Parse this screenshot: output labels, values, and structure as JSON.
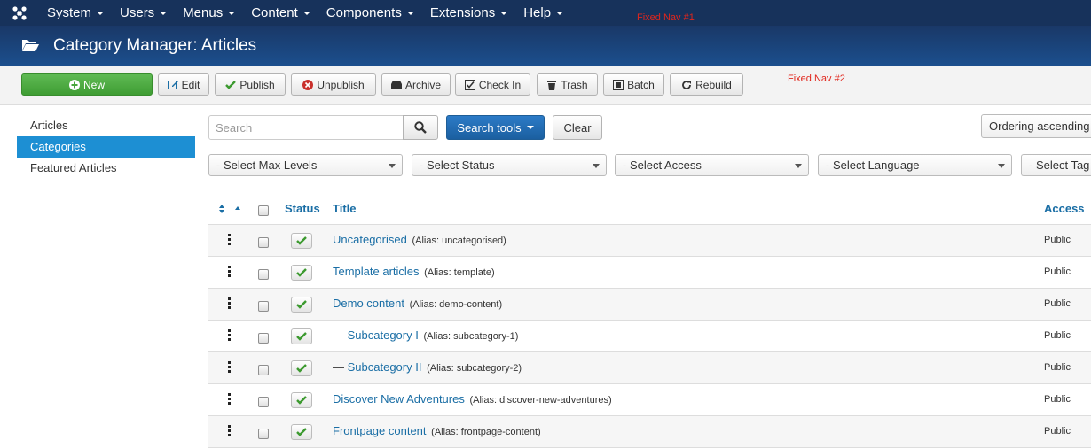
{
  "topnav": {
    "menu": [
      "System",
      "Users",
      "Menus",
      "Content",
      "Components",
      "Extensions",
      "Help"
    ],
    "note": "Fixed Nav  #1"
  },
  "header": {
    "title": "Category Manager: Articles"
  },
  "toolbar": {
    "buttons": [
      "New",
      "Edit",
      "Publish",
      "Unpublish",
      "Archive",
      "Check In",
      "Trash",
      "Batch",
      "Rebuild"
    ],
    "note": "Fixed Nav  #2"
  },
  "sidebar": {
    "items": [
      "Articles",
      "Categories",
      "Featured Articles"
    ],
    "active": "Categories"
  },
  "search": {
    "placeholder": "Search",
    "tools_label": "Search tools",
    "clear_label": "Clear"
  },
  "ordering": {
    "label": "Ordering ascending"
  },
  "filters": [
    "- Select Max Levels",
    "- Select Status",
    "- Select Access",
    "- Select Language",
    "- Select Tag"
  ],
  "table": {
    "headers": {
      "status": "Status",
      "title": "Title",
      "access": "Access"
    },
    "rows": [
      {
        "prefix": "",
        "title": "Uncategorised",
        "alias": "(Alias: uncategorised)",
        "access": "Public"
      },
      {
        "prefix": "",
        "title": "Template articles",
        "alias": "(Alias: template)",
        "access": "Public"
      },
      {
        "prefix": "",
        "title": "Demo content",
        "alias": "(Alias: demo-content)",
        "access": "Public"
      },
      {
        "prefix": "—",
        "title": "Subcategory I",
        "alias": "(Alias: subcategory-1)",
        "access": "Public"
      },
      {
        "prefix": "—",
        "title": "Subcategory II",
        "alias": "(Alias: subcategory-2)",
        "access": "Public"
      },
      {
        "prefix": "",
        "title": "Discover New Adventures",
        "alias": "(Alias: discover-new-adventures)",
        "access": "Public"
      },
      {
        "prefix": "",
        "title": "Frontpage content",
        "alias": "(Alias: frontpage-content)",
        "access": "Public"
      }
    ]
  },
  "colors": {
    "nav": "#17325b",
    "header": "#1b4f8e",
    "accent": "#1d8fd3",
    "new_button": "#4aa83e",
    "published_check": "#3c9a2f",
    "note": "#e1261c"
  }
}
